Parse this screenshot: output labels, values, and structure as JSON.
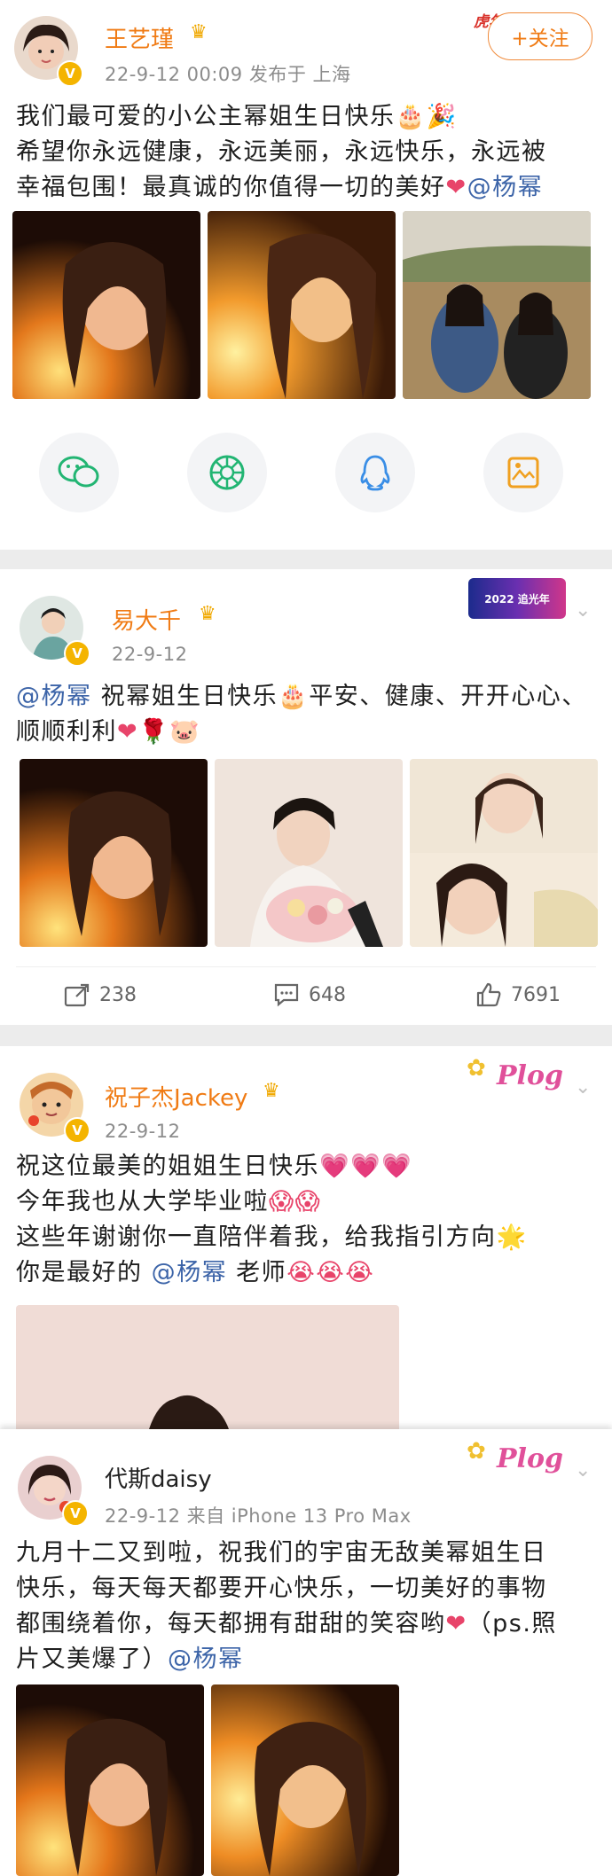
{
  "posts": [
    {
      "username": "王艺瑾",
      "meta": "22-9-12 00:09  发布于 上海",
      "follow": "+关注",
      "decor": "虎年",
      "text": {
        "l1": "我们最可爱的小公主幂姐生日快乐",
        "l1_emoji": "🎂🎉",
        "l2": "希望你永远健康，永远美丽，永远快乐，永远被",
        "l3": "幸福包围！最真诚的你值得一切的美好",
        "l3_emoji": "❤",
        "l3_mention": "@杨幂"
      }
    },
    {
      "username": "易大千",
      "meta": "22-9-12",
      "decor": "2022 追光年",
      "text": {
        "l1_mention": "@杨幂",
        "l1": " 祝幂姐生日快乐",
        "l1_emoji": "🎂",
        "l1b": "平安、健康、开开心心、",
        "l2": "顺顺利利",
        "l2_emoji": "❤🌹🐷"
      },
      "actions": {
        "share": "238",
        "comment": "648",
        "like": "7691"
      }
    },
    {
      "username": "祝子杰Jackey",
      "meta": "22-9-12",
      "decor": "Plog",
      "text": {
        "l1": "祝这位最美的姐姐生日快乐",
        "l1_emoji": "💗💗💗",
        "l2": "今年我也从大学毕业啦",
        "l2_emoji": "😱😱",
        "l3": "这些年谢谢你一直陪伴着我，给我指引方向",
        "l3_emoji": "🌟",
        "l4a": "你是最好的 ",
        "l4_mention": "@杨幂",
        "l4b": " 老师",
        "l4_emoji": "😭😭😭"
      }
    },
    {
      "username": "代斯daisy",
      "meta": "22-9-12  来自 iPhone 13 Pro Max",
      "decor": "Plog",
      "text": {
        "l1": "九月十二又到啦，祝我们的宇宙无敌美幂姐生日",
        "l2": "快乐，每天每天都要开心快乐，一切美好的事物",
        "l3": "都围绕着你，每天都拥有甜甜的笑容哟",
        "l3_emoji": "❤",
        "l3b": "（ps.照",
        "l4": "片又美爆了）",
        "l4_mention": "@杨幂"
      }
    }
  ],
  "icons": [
    "wechat-icon",
    "moments-icon",
    "qq-icon",
    "save-image-icon",
    "share-icon",
    "comment-icon",
    "like-icon",
    "chevron-down-icon",
    "crown-icon",
    "verified-icon"
  ],
  "colors": {
    "username": "#f07b14",
    "mention": "#3c64a8",
    "meta": "#8c8c8c",
    "background": "#ececec"
  }
}
